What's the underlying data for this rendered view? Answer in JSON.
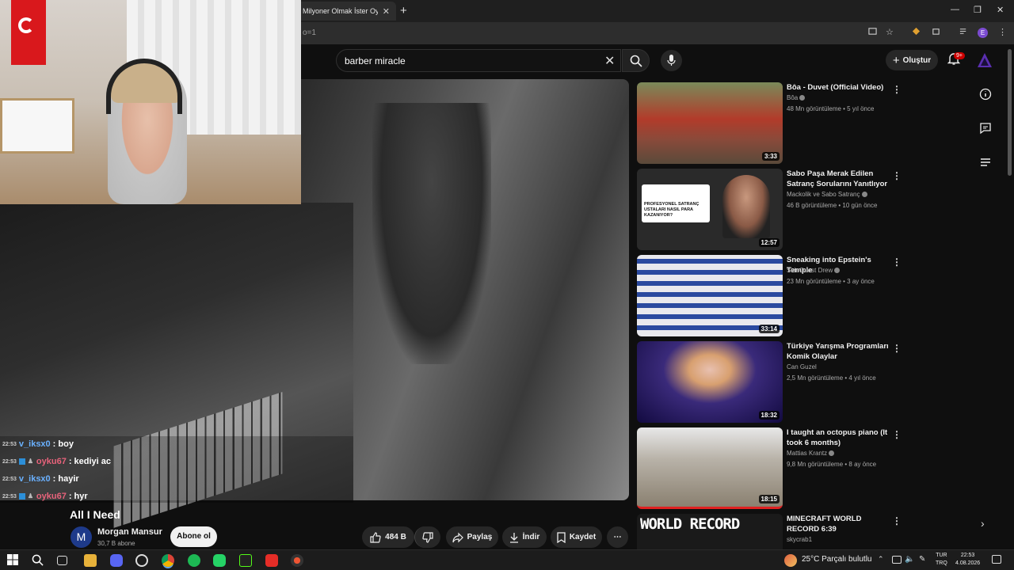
{
  "browser": {
    "tab_title": "Milyoner Olmak İster Oyun",
    "tab_close": "✕",
    "new_tab": "+",
    "url_fragment": "o=1",
    "profile_initial": "E",
    "window_controls": [
      "—",
      "❐",
      "✕"
    ]
  },
  "youtube": {
    "search_query": "barber miracle",
    "create_label": "Oluştur",
    "notifications_badge": "9+"
  },
  "chat": [
    {
      "time": "22:53",
      "user": "v_iksx0",
      "message": ": boy",
      "color": "#6ab1ff",
      "badges": 0
    },
    {
      "time": "22:53",
      "user": "oyku67",
      "message": ": kediyi ac",
      "color": "#e8637b",
      "badges": 2
    },
    {
      "time": "22:53",
      "user": "v_iksx0",
      "message": ": hayir",
      "color": "#6ab1ff",
      "badges": 0
    },
    {
      "time": "22:53",
      "user": "oyku67",
      "message": ": hyr",
      "color": "#e8637b",
      "badges": 2
    }
  ],
  "video": {
    "title": "All I Need",
    "channel_initial": "M",
    "channel": "Morgan Mansur",
    "subscribers": "30,7 B abone",
    "subscribe_label": "Abone ol",
    "likes": "484 B",
    "share_label": "Paylaş",
    "download_label": "İndir",
    "save_label": "Kaydet",
    "more_label": "⋯"
  },
  "recommendations": [
    {
      "title": "Bôa -  Duvet (Official Video)",
      "channel": "Bôa",
      "meta": "48 Mn görüntüleme • 5 yıl önce",
      "duration": "3:33",
      "verified": true
    },
    {
      "title": "Sabo Paşa Merak Edilen Satranç Sorularını Yanıtlıyor | ...",
      "channel": "Mackolik  ve Sabo Satranç",
      "meta": "46 B görüntüleme • 10 gün önce",
      "duration": "12:57",
      "verified": true,
      "thumb_text": "PROFESYONEL SATRANÇ USTALARI NASIL PARA KAZANIYOR?"
    },
    {
      "title": "Sneaking into Epstein's Temple",
      "channel": "SideQuest Drew",
      "meta": "23 Mn görüntüleme • 3 ay önce",
      "duration": "33:14",
      "verified": true
    },
    {
      "title": "Türkiye Yarışma Programları Komik Olaylar",
      "channel": "Can Guzel",
      "meta": "2,5 Mn görüntüleme • 4 yıl önce",
      "duration": "18:32",
      "verified": false
    },
    {
      "title": "I taught an octopus piano (It took 6 months)",
      "channel": "Mattias Krantz",
      "meta": "9,8 Mn görüntüleme • 8 ay önce",
      "duration": "18:15",
      "verified": true
    },
    {
      "title": "MINECRAFT WORLD RECORD 6:39",
      "channel": "skycrab1",
      "meta": "",
      "duration": "",
      "verified": false,
      "thumb_text": "WORLD RECORD"
    }
  ],
  "taskbar": {
    "weather": "25°C  Parçalı bulutlu",
    "lang_top": "TUR",
    "lang_bottom": "TRQ",
    "time": "22:53",
    "date": "4.08.2026"
  },
  "colors": {
    "background": "#0f0f0f",
    "subscribe_bg": "#f1f1f1",
    "badge_red": "#cc0000"
  }
}
